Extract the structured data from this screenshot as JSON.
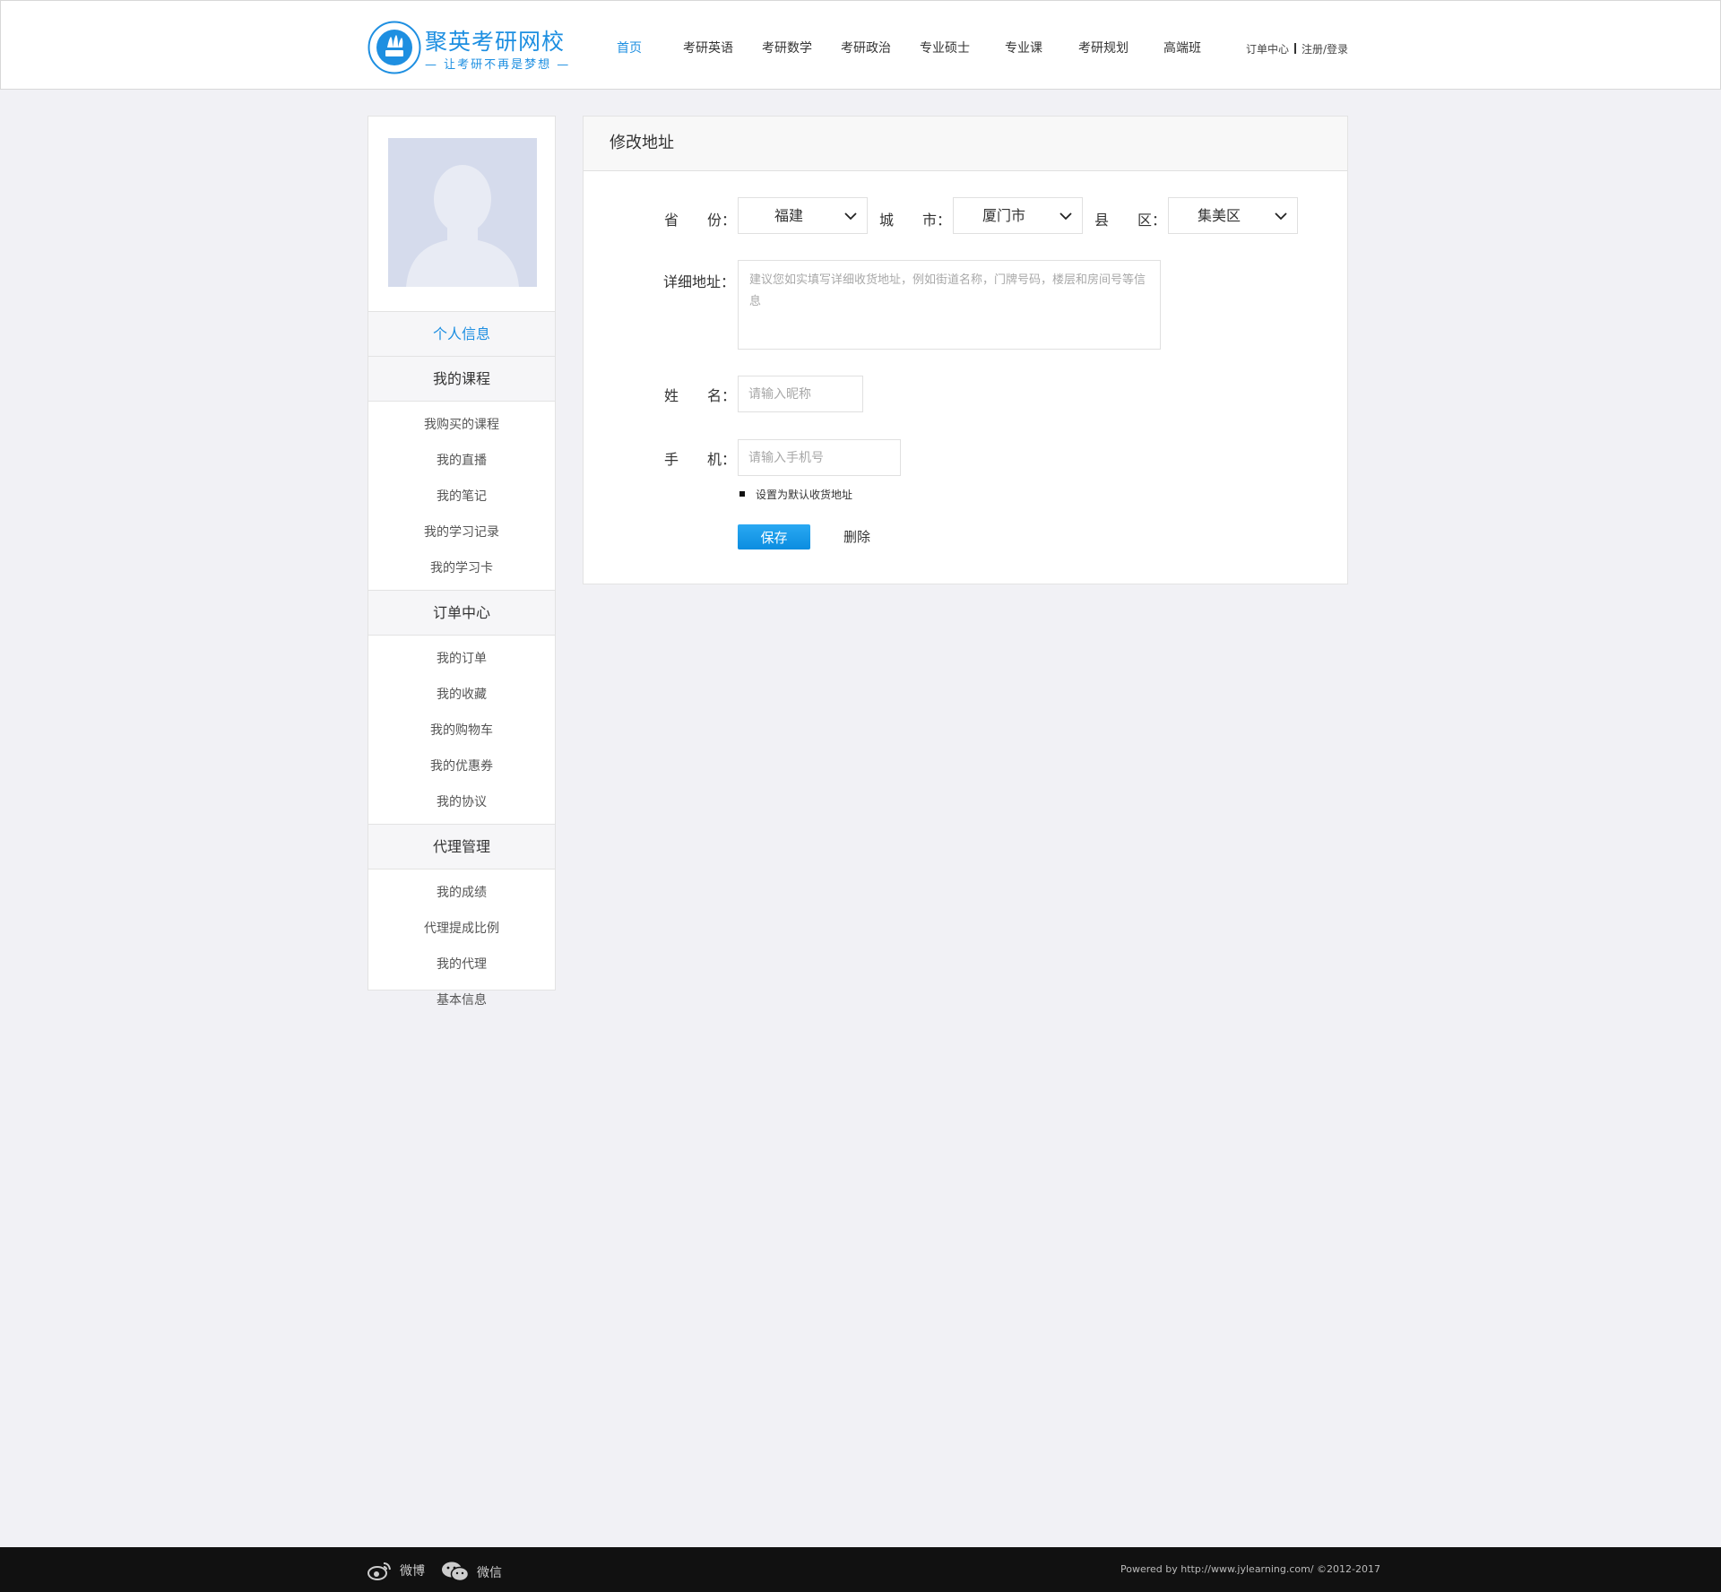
{
  "header": {
    "logo_name": "聚英考研网校",
    "logo_slogan": "— 让考研不再是梦想 —",
    "nav": [
      "首页",
      "考研英语",
      "考研数学",
      "考研政治",
      "专业硕士",
      "专业课",
      "考研规划",
      "高端班"
    ],
    "active_nav": "首页",
    "order_center": "订单中心",
    "login": "注册/登录"
  },
  "sidebar": {
    "personal_info": "个人信息",
    "sections": [
      {
        "title": "我的课程",
        "items": [
          "我购买的课程",
          "我的直播",
          "我的笔记",
          "我的学习记录",
          "我的学习卡"
        ]
      },
      {
        "title": "订单中心",
        "items": [
          "我的订单",
          "我的收藏",
          "我的购物车",
          "我的优惠券",
          "我的协议"
        ]
      },
      {
        "title": "代理管理",
        "items": [
          "我的成绩",
          "代理提成比例",
          "我的代理",
          "基本信息"
        ]
      }
    ]
  },
  "form": {
    "title": "修改地址",
    "province_label_a": "省",
    "province_label_b": "份：",
    "province_value": "福建",
    "city_label_a": "城",
    "city_label_b": "市：",
    "city_value": "厦门市",
    "county_label_a": "县",
    "county_label_b": "区：",
    "county_value": "集美区",
    "address_label": "详细地址：",
    "address_placeholder": "建议您如实填写详细收货地址，例如街道名称，门牌号码，楼层和房间号等信息",
    "name_label_a": "姓",
    "name_label_b": "名：",
    "name_placeholder": "请输入昵称",
    "phone_label_a": "手",
    "phone_label_b": "机：",
    "phone_placeholder": "请输入手机号",
    "default_checkbox": "设置为默认收货地址",
    "save": "保存",
    "delete": "删除"
  },
  "footer": {
    "weibo": "微博",
    "wechat": "微信",
    "copyright": "Powered by http://www.jylearning.com/ ©2012-2017"
  },
  "colors": {
    "accent": "#1e8fe1",
    "page_bg": "#f1f1f5",
    "footer_bg": "#111111"
  }
}
